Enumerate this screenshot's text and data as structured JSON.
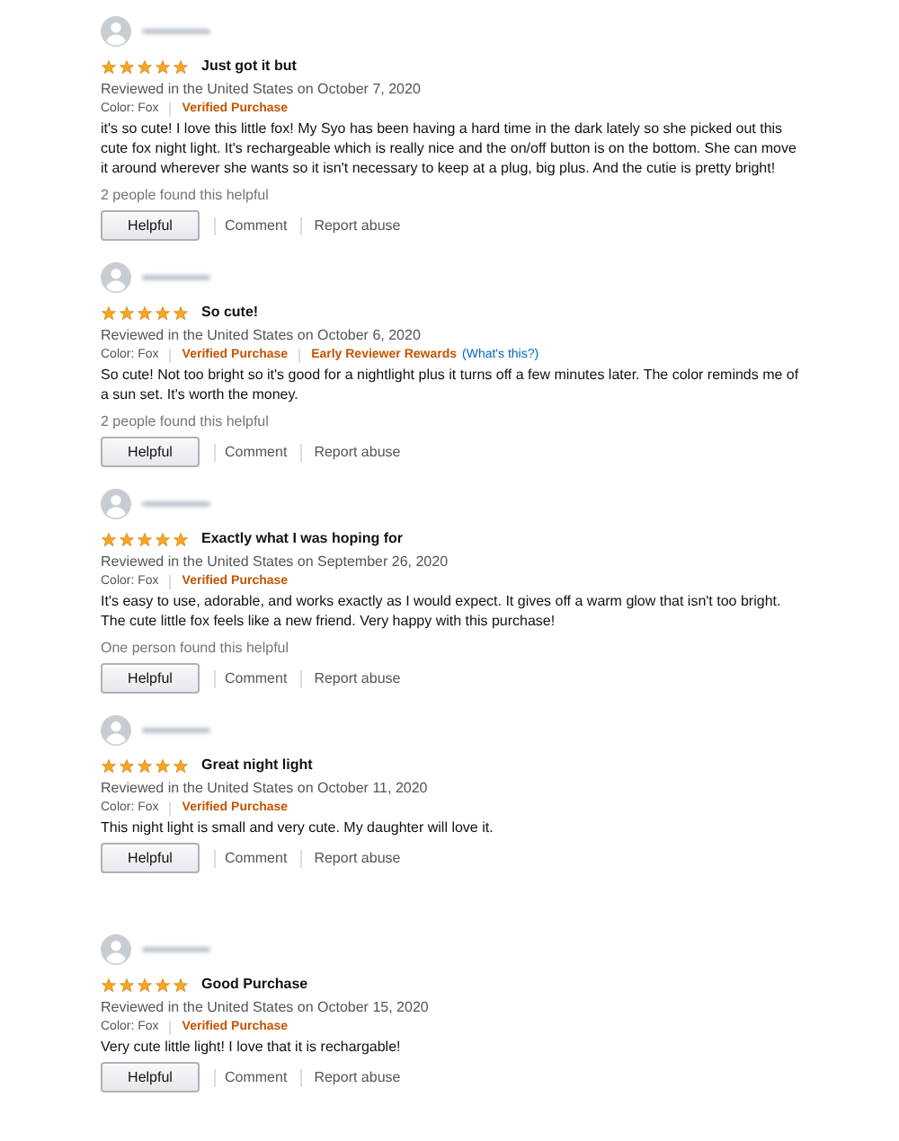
{
  "reviews": [
    {
      "stars": 5,
      "title": "Just got it but",
      "date": "Reviewed in the United States on October 7, 2020",
      "color_label": "Color: Fox",
      "badges": [
        {
          "kind": "verified",
          "text": "Verified Purchase"
        }
      ],
      "body": "it's so cute! I love this little fox! My Syo has been having a hard time in the dark lately so she picked out this cute fox night light. It's rechargeable which is really nice and the on/off button is on the bottom. She can move it around wherever she wants so it isn't necessary to keep at a plug, big plus. And the cutie is pretty bright!",
      "helpful_count": "2 people found this helpful",
      "actions": {
        "helpful": "Helpful",
        "comment": "Comment",
        "report": "Report abuse"
      }
    },
    {
      "stars": 5,
      "title": "So cute!",
      "date": "Reviewed in the United States on October 6, 2020",
      "color_label": "Color: Fox",
      "badges": [
        {
          "kind": "verified",
          "text": "Verified Purchase"
        },
        {
          "kind": "reward",
          "text": "Early Reviewer Rewards",
          "link": "(What's this?)"
        }
      ],
      "body": "So cute! Not too bright so it's good for a nightlight plus it turns off a few minutes later. The color reminds me of a sun set. It's worth the money.",
      "helpful_count": "2 people found this helpful",
      "actions": {
        "helpful": "Helpful",
        "comment": "Comment",
        "report": "Report abuse"
      }
    },
    {
      "stars": 5,
      "title": "Exactly what I was hoping for",
      "date": "Reviewed in the United States on September 26, 2020",
      "color_label": "Color: Fox",
      "badges": [
        {
          "kind": "verified",
          "text": "Verified Purchase"
        }
      ],
      "body": "It's easy to use, adorable, and works exactly as I would expect. It gives off a warm glow that isn't too bright. The cute little fox feels like a new friend. Very happy with this purchase!",
      "helpful_count": "One person found this helpful",
      "actions": {
        "helpful": "Helpful",
        "comment": "Comment",
        "report": "Report abuse"
      }
    },
    {
      "stars": 5,
      "title": "Great night light",
      "date": "Reviewed in the United States on October 11, 2020",
      "color_label": "Color: Fox",
      "badges": [
        {
          "kind": "verified",
          "text": "Verified Purchase"
        }
      ],
      "body": "This night light is small and very cute. My daughter will love it.",
      "actions": {
        "helpful": "Helpful",
        "comment": "Comment",
        "report": "Report abuse"
      }
    },
    {
      "stars": 5,
      "title": "Good Purchase",
      "date": "Reviewed in the United States on October 15, 2020",
      "color_label": "Color: Fox",
      "badges": [
        {
          "kind": "verified",
          "text": "Verified Purchase"
        }
      ],
      "body": "Very cute little light! I love that it is rechargable!",
      "actions": {
        "helpful": "Helpful",
        "comment": "Comment",
        "report": "Report abuse"
      }
    }
  ]
}
